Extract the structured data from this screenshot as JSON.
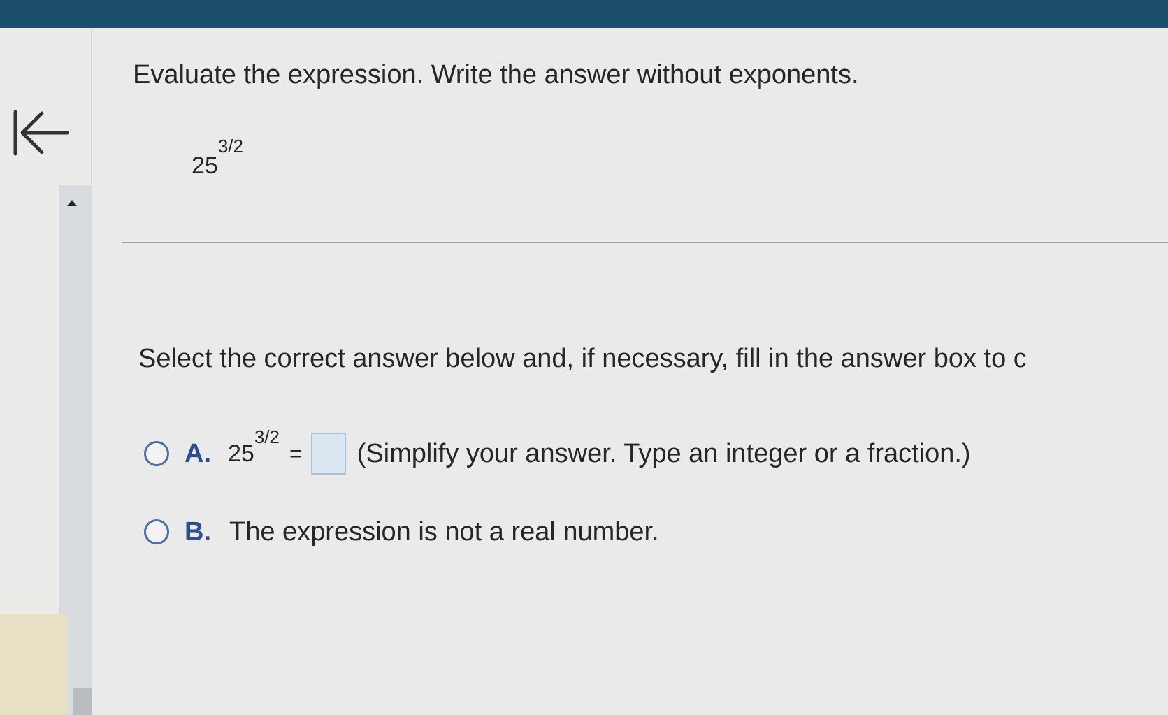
{
  "question": {
    "instruction": "Evaluate the expression. Write the answer without exponents.",
    "expression": {
      "base": "25",
      "exponent": "3/2"
    }
  },
  "answer_prompt": "Select the correct answer below and, if necessary, fill in the answer box to c",
  "options": [
    {
      "letter": "A.",
      "expression": {
        "base": "25",
        "exponent": "3/2"
      },
      "equals": "=",
      "answer_value": "",
      "hint": "(Simplify your answer. Type an integer or a fraction.)"
    },
    {
      "letter": "B.",
      "text": "The expression is not a real number."
    }
  ],
  "colors": {
    "top_bar": "#1c4f6c",
    "radio_border": "#4e6fa6",
    "option_letter": "#2c4f92",
    "answer_box": "#dbe6f1"
  },
  "icons": {
    "collapse": "collapse-left-icon",
    "scroll_up": "scroll-up-arrow-icon"
  }
}
